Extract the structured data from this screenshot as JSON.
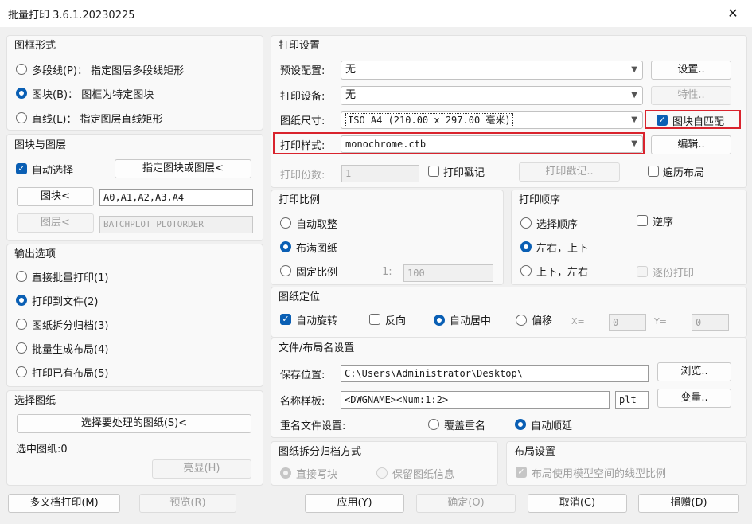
{
  "window": {
    "title": "批量打印 3.6.1.20230225",
    "close_glyph": "✕"
  },
  "frame_form": {
    "title": "图框形式",
    "options": [
      {
        "label": "多段线(P)： 指定图层多段线矩形",
        "selected": false
      },
      {
        "label": "图块(B)： 图框为特定图块",
        "selected": true
      },
      {
        "label": "直线(L)： 指定图层直线矩形",
        "selected": false
      }
    ]
  },
  "block_layer": {
    "title": "图块与图层",
    "auto_select": "自动选择",
    "specify_button": "指定图块或图层<",
    "block_button": "图块<",
    "block_value": "A0,A1,A2,A3,A4",
    "layer_button": "图层<",
    "layer_value": "BATCHPLOT_PLOTORDER"
  },
  "output": {
    "title": "输出选项",
    "options": [
      {
        "label": "直接批量打印(1)",
        "selected": false
      },
      {
        "label": "打印到文件(2)",
        "selected": true
      },
      {
        "label": "图纸拆分归档(3)",
        "selected": false
      },
      {
        "label": "批量生成布局(4)",
        "selected": false
      },
      {
        "label": "打印已有布局(5)",
        "selected": false
      }
    ]
  },
  "select_sheets": {
    "title": "选择图纸",
    "button": "选择要处理的图纸(S)<",
    "status": "选中图纸:0",
    "highlight_button": "亮显(H)"
  },
  "print_settings": {
    "title": "打印设置",
    "preset_label": "预设配置:",
    "preset_value": "无",
    "settings_button": "设置..",
    "device_label": "打印设备:",
    "device_value": "无",
    "props_button": "特性..",
    "paper_label": "图纸尺寸:",
    "paper_value": "ISO A4 (210.00 x 297.00 毫米)",
    "block_match": "图块自匹配",
    "style_label": "打印样式:",
    "style_value": "monochrome.ctb",
    "edit_button": "编辑..",
    "copies_label": "打印份数:",
    "copies_value": "1",
    "stamp_check": "打印戳记",
    "stamp_button": "打印戳记..",
    "traverse_layout": "遍历布局"
  },
  "scale": {
    "title": "打印比例",
    "options": [
      {
        "label": "自动取整",
        "selected": false
      },
      {
        "label": "布满图纸",
        "selected": true
      },
      {
        "label": "固定比例",
        "selected": false
      }
    ],
    "ratio_prefix": "1:",
    "ratio_value": "100"
  },
  "order": {
    "title": "打印顺序",
    "options": [
      {
        "label": "选择顺序",
        "selected": false
      },
      {
        "label": "左右，上下",
        "selected": true
      },
      {
        "label": "上下，左右",
        "selected": false
      }
    ],
    "reverse": "逆序",
    "copy_print": "逐份打印"
  },
  "paper_pos": {
    "title": "图纸定位",
    "auto_rotate": "自动旋转",
    "reverse": "反向",
    "auto_center": "自动居中",
    "offset": "偏移",
    "x_label": "X=",
    "x_value": "0",
    "y_label": "Y=",
    "y_value": "0"
  },
  "file_settings": {
    "title": "文件/布局名设置",
    "save_label": "保存位置:",
    "save_value": "C:\\Users\\Administrator\\Desktop\\",
    "browse_button": "浏览..",
    "name_label": "名称样板:",
    "name_value": "<DWGNAME><Num:1:2>",
    "ext_value": "plt",
    "vars_button": "变量..",
    "rename_label": "重名文件设置:",
    "rename_options": [
      {
        "label": "覆盖重名",
        "selected": false
      },
      {
        "label": "自动顺延",
        "selected": true
      }
    ]
  },
  "archive": {
    "title": "图纸拆分归档方式",
    "options": [
      {
        "label": "直接写块",
        "selected": true
      },
      {
        "label": "保留图纸信息",
        "selected": false
      }
    ]
  },
  "layout_settings": {
    "title": "布局设置",
    "linetype": "布局使用模型空间的线型比例"
  },
  "footer": {
    "multi_doc": "多文档打印(M)",
    "preview": "预览(R)",
    "apply": "应用(Y)",
    "ok": "确定(O)",
    "cancel": "取消(C)",
    "donate": "捐赠(D)"
  },
  "colors": {
    "accent": "#0a5fb4",
    "highlight_border": "#d9232d"
  }
}
